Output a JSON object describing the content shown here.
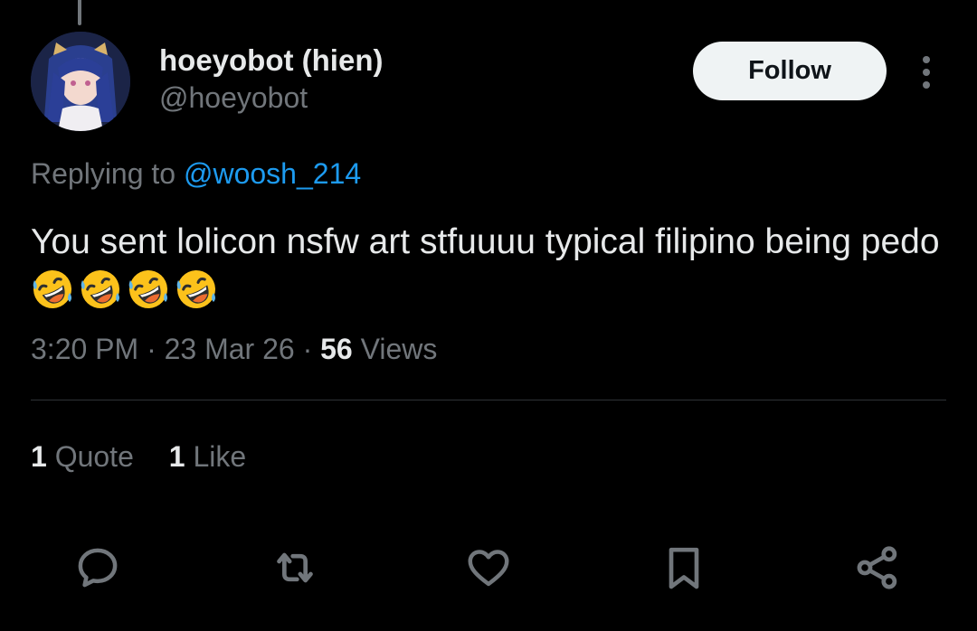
{
  "author": {
    "display_name": "hoeyobot (hien)",
    "handle": "@hoeyobot",
    "follow_label": "Follow"
  },
  "reply": {
    "prefix": "Replying to ",
    "handle": "@woosh_214"
  },
  "tweet": {
    "text": "You sent lolicon nsfw art stfuuuu typical filipino being pedo",
    "emoji_count": 4
  },
  "meta": {
    "time": "3:20 PM",
    "sep1": " · ",
    "date": "23 Mar 26",
    "sep2": " · ",
    "views_count": "56",
    "views_label": " Views"
  },
  "stats": {
    "quotes_count": "1",
    "quotes_label": " Quote",
    "likes_count": "1",
    "likes_label": " Like"
  },
  "actions": [
    "reply-icon",
    "retweet-icon",
    "like-icon",
    "bookmark-icon",
    "share-icon"
  ],
  "colors": {
    "background": "#000000",
    "text": "#e7e9ea",
    "muted": "#71767b",
    "link": "#1d9bf0",
    "button_bg": "#eff3f4"
  }
}
